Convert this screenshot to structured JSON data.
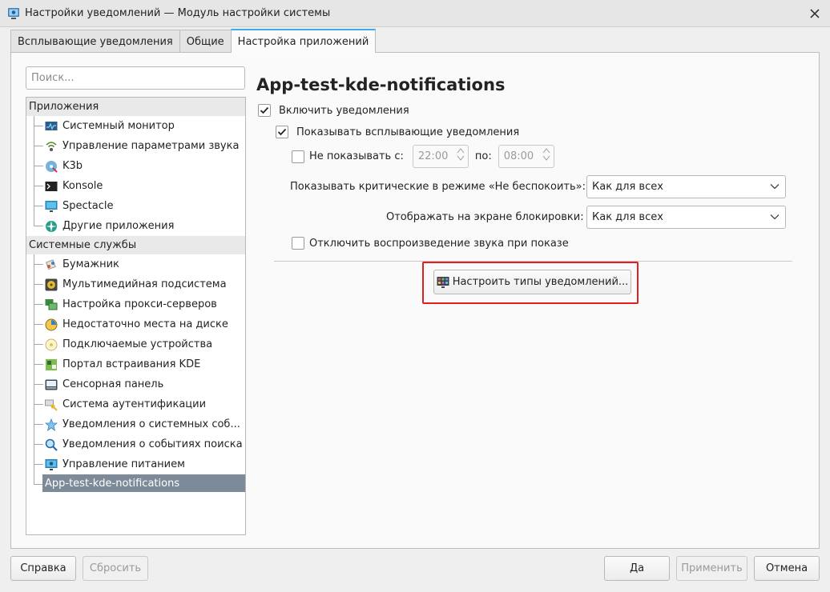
{
  "window": {
    "title": "Настройки уведомлений — Модуль настройки системы"
  },
  "tabs": [
    {
      "label": "Всплывающие уведомления"
    },
    {
      "label": "Общие"
    },
    {
      "label": "Настройка приложений"
    }
  ],
  "search": {
    "placeholder": "Поиск..."
  },
  "sidebar": {
    "groups": [
      {
        "header": "Приложения",
        "items": [
          {
            "label": "Системный монитор",
            "icon": "system-monitor-icon"
          },
          {
            "label": "Управление параметрами звука",
            "icon": "audio-settings-icon"
          },
          {
            "label": "K3b",
            "icon": "k3b-icon"
          },
          {
            "label": "Konsole",
            "icon": "terminal-icon"
          },
          {
            "label": "Spectacle",
            "icon": "spectacle-icon"
          },
          {
            "label": "Другие приложения",
            "icon": "other-apps-icon"
          }
        ]
      },
      {
        "header": "Системные службы",
        "items": [
          {
            "label": "Бумажник",
            "icon": "wallet-icon"
          },
          {
            "label": "Мультимедийная подсистема",
            "icon": "multimedia-icon"
          },
          {
            "label": "Настройка прокси-серверов",
            "icon": "proxy-icon"
          },
          {
            "label": "Недостаточно места на диске",
            "icon": "disk-space-icon"
          },
          {
            "label": "Подключаемые устройства",
            "icon": "devices-icon"
          },
          {
            "label": "Портал встраивания KDE",
            "icon": "kde-portal-icon"
          },
          {
            "label": "Сенсорная панель",
            "icon": "touchpad-icon"
          },
          {
            "label": "Система аутентификации",
            "icon": "authentication-icon"
          },
          {
            "label": "Уведомления о системных соб...",
            "icon": "system-events-icon"
          },
          {
            "label": "Уведомления о событиях поиска",
            "icon": "search-events-icon"
          },
          {
            "label": "Управление питанием",
            "icon": "power-icon"
          }
        ]
      }
    ],
    "selected": "App-test-kde-notifications"
  },
  "main": {
    "title": "App-test-kde-notifications",
    "enable_label": "Включить уведомления",
    "enable_checked": true,
    "popup_label": "Показывать всплывающие уведомления",
    "popup_checked": true,
    "quiet_label": "Не показывать с:",
    "quiet_checked": false,
    "quiet_from": "22:00",
    "quiet_to_label": "по:",
    "quiet_to": "08:00",
    "dnd_label": "Показывать критические в режиме «Не беспокоить»:",
    "dnd_value": "Как для всех",
    "lock_label": "Отображать на экране блокировки:",
    "lock_value": "Как для всех",
    "mute_label": "Отключить воспроизведение звука при показе",
    "mute_checked": false,
    "configure_button": "Настроить типы уведомлений..."
  },
  "footer": {
    "help": "Справка",
    "reset": "Сбросить",
    "ok": "Да",
    "apply": "Применить",
    "cancel": "Отмена"
  },
  "colors": {
    "accent": "#3daee9",
    "selection": "#7d8a99",
    "highlight_border": "#e02020"
  }
}
